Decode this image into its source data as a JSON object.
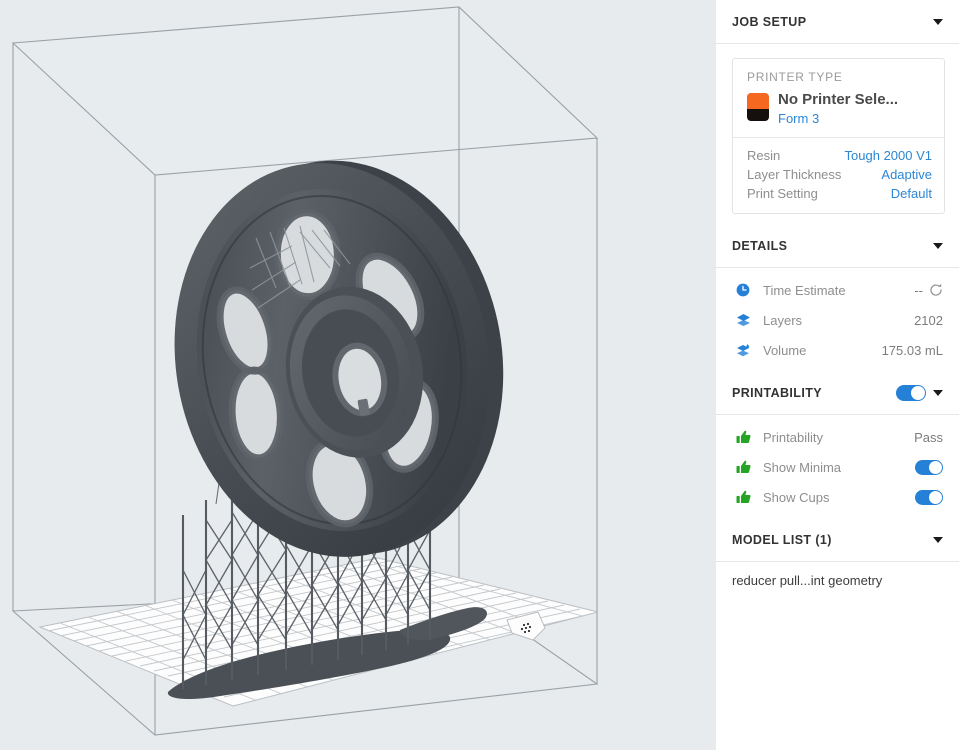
{
  "viewport": {
    "name": "3d-build-viewport",
    "background_color": "#e7ebee",
    "build_volume_color": "#9aa0a4",
    "model_color": "#555b60",
    "platform_color": "#fdfdfd",
    "grid_color": "#b9bec2"
  },
  "nav": {
    "home_icon": "home-orientation-icon",
    "dpad": {
      "up_glyph": "▲",
      "down_glyph": "▼",
      "left_glyph": "◀",
      "right_glyph": "▶",
      "center_icon": "recenter-dot-icon"
    },
    "zoom_in_glyph": "+",
    "zoom_out_glyph": "−",
    "slider_name": "clipping-slider"
  },
  "panel": {
    "job_setup": {
      "title": "JOB SETUP",
      "printer_type_label": "PRINTER TYPE",
      "printer_name": "No Printer Sele...",
      "printer_model": "Form 3",
      "printer_icon": "printer-icon",
      "rows": [
        {
          "key": "Resin",
          "value": "Tough 2000 V1"
        },
        {
          "key": "Layer Thickness",
          "value": "Adaptive"
        },
        {
          "key": "Print Setting",
          "value": "Default"
        }
      ]
    },
    "details": {
      "title": "DETAILS",
      "rows": [
        {
          "icon": "clock-icon",
          "label": "Time Estimate",
          "value": "--",
          "has_refresh": true
        },
        {
          "icon": "layers-icon",
          "label": "Layers",
          "value": "2102",
          "has_refresh": false
        },
        {
          "icon": "volume-icon",
          "label": "Volume",
          "value": "175.03 mL",
          "has_refresh": false
        }
      ]
    },
    "printability": {
      "title": "PRINTABILITY",
      "master_toggle": true,
      "rows": [
        {
          "icon": "thumbs-up-icon",
          "label": "Printability",
          "value": "Pass",
          "toggle": null
        },
        {
          "icon": "thumbs-up-icon",
          "label": "Show Minima",
          "value": "",
          "toggle": true
        },
        {
          "icon": "thumbs-up-icon",
          "label": "Show Cups",
          "value": "",
          "toggle": true
        }
      ]
    },
    "model_list": {
      "title": "MODEL LIST (1)",
      "items": [
        {
          "name": "reducer pull...int geometry"
        }
      ]
    },
    "colors": {
      "accent_blue": "#2b86d4",
      "toggle_blue": "#2481d7",
      "thumb_green": "#24a524",
      "printer_orange": "#f4691f",
      "muted_text": "#8e8e8e",
      "heading_text": "#333333"
    }
  }
}
